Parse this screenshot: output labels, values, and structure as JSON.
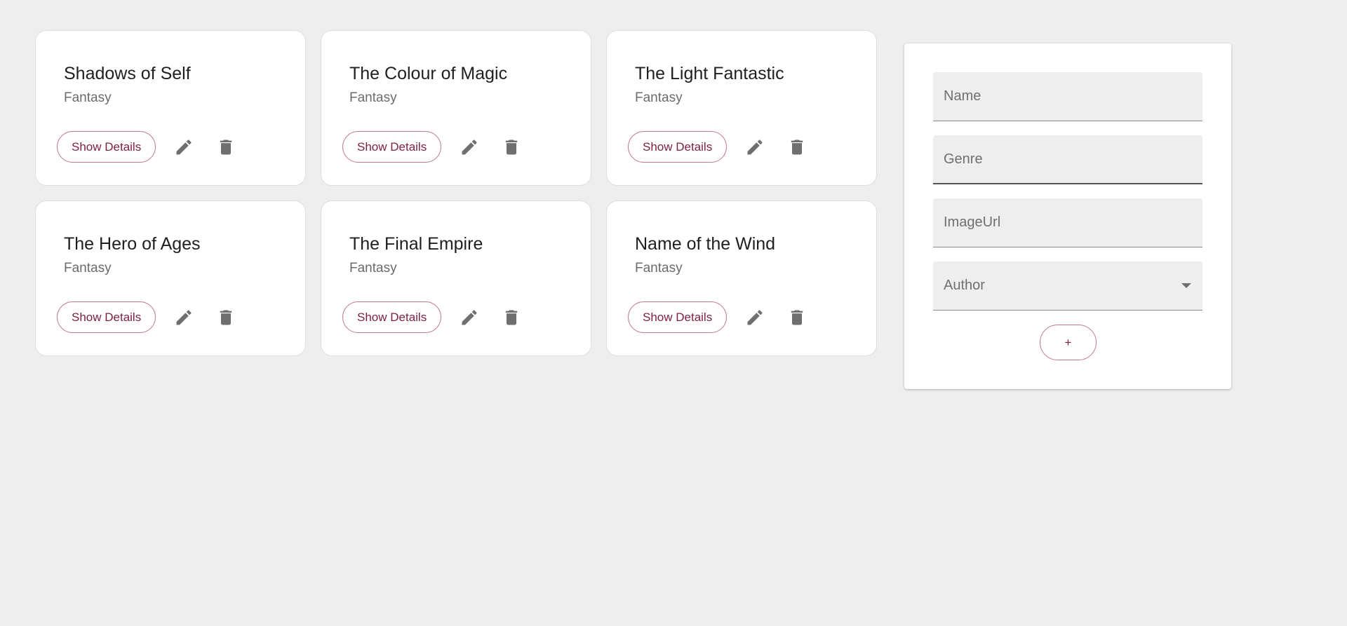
{
  "books": [
    {
      "title": "Shadows of Self",
      "genre": "Fantasy"
    },
    {
      "title": "The Colour of Magic",
      "genre": "Fantasy"
    },
    {
      "title": "The Light Fantastic",
      "genre": "Fantasy"
    },
    {
      "title": "The Hero of Ages",
      "genre": "Fantasy"
    },
    {
      "title": "The Final Empire",
      "genre": "Fantasy"
    },
    {
      "title": "Name of the Wind",
      "genre": "Fantasy"
    }
  ],
  "card_actions": {
    "details_label": "Show Details",
    "edit_icon": "pencil-icon",
    "delete_icon": "trash-icon"
  },
  "form": {
    "name": {
      "placeholder": "Name",
      "value": ""
    },
    "genre": {
      "placeholder": "Genre",
      "value": ""
    },
    "image_url": {
      "placeholder": "ImageUrl",
      "value": ""
    },
    "author": {
      "label": "Author",
      "icon": "chevron-down-icon"
    },
    "add_label": "+"
  },
  "colors": {
    "background": "#eeeeee",
    "card": "#ffffff",
    "accent": "#7b1e43",
    "accent_border": "#c27a92",
    "icon": "#6f6f6f"
  }
}
